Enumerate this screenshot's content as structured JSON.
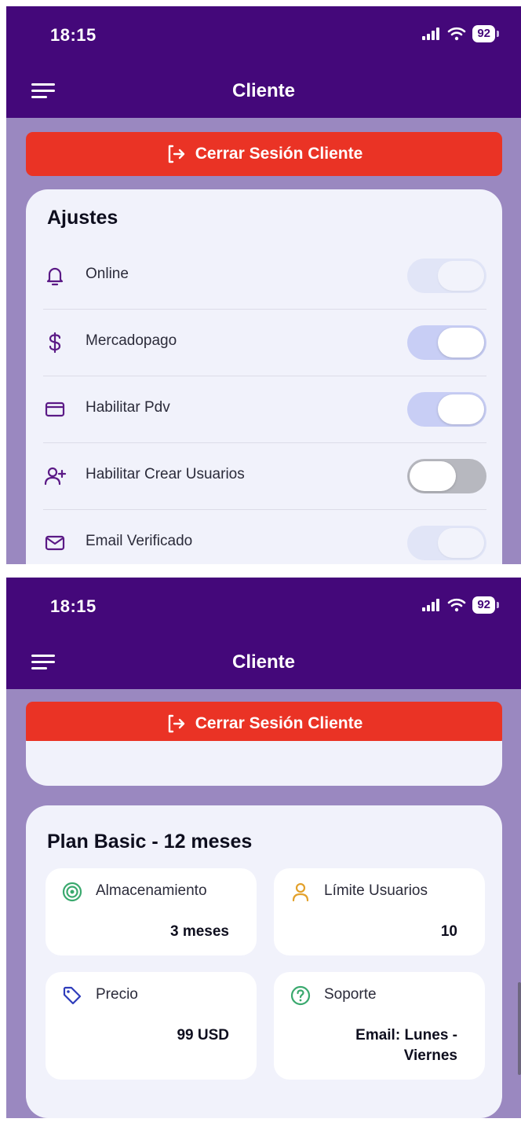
{
  "screens": [
    {
      "status": {
        "time": "18:15",
        "battery": "92"
      },
      "header": {
        "title": "Cliente"
      },
      "logout_label": "Cerrar Sesión Cliente",
      "settings": {
        "title": "Ajustes",
        "items": [
          {
            "label": "Online",
            "icon": "bell-icon",
            "state": "on (disabled)"
          },
          {
            "label": "Mercadopago",
            "icon": "dollar-icon",
            "state": "on"
          },
          {
            "label": "Habilitar Pdv",
            "icon": "credit-card-icon",
            "state": "on"
          },
          {
            "label": "Habilitar Crear Usuarios",
            "icon": "user-plus-icon",
            "state": "off"
          },
          {
            "label": "Email Verificado",
            "icon": "mail-icon",
            "state": "on (disabled)"
          }
        ]
      }
    },
    {
      "status": {
        "time": "18:15",
        "battery": "92"
      },
      "header": {
        "title": "Cliente"
      },
      "logout_label": "Cerrar Sesión Cliente",
      "plan": {
        "title": "Plan Basic - 12 meses",
        "tiles": [
          {
            "label": "Almacenamiento",
            "value": "3 meses",
            "icon": "target-icon"
          },
          {
            "label": "Límite Usuarios",
            "value": "10",
            "icon": "user-icon"
          },
          {
            "label": "Precio",
            "value": "99 USD",
            "icon": "tag-icon"
          },
          {
            "label": "Soporte",
            "value": "Email: Lunes - Viernes",
            "icon": "help-circle-icon"
          }
        ]
      }
    }
  ],
  "colors": {
    "header_bg": "#44087a",
    "page_bg": "#9a88c0",
    "logout_bg": "#ea3325",
    "card_bg": "#f1f2fb",
    "icon_purple": "#5b1a86",
    "toggle_on": "#c8cef5",
    "toggle_off": "#b7b8bf",
    "accent_green": "#3aa96e",
    "accent_orange": "#e3a12b",
    "accent_blue": "#2f3dbb"
  }
}
